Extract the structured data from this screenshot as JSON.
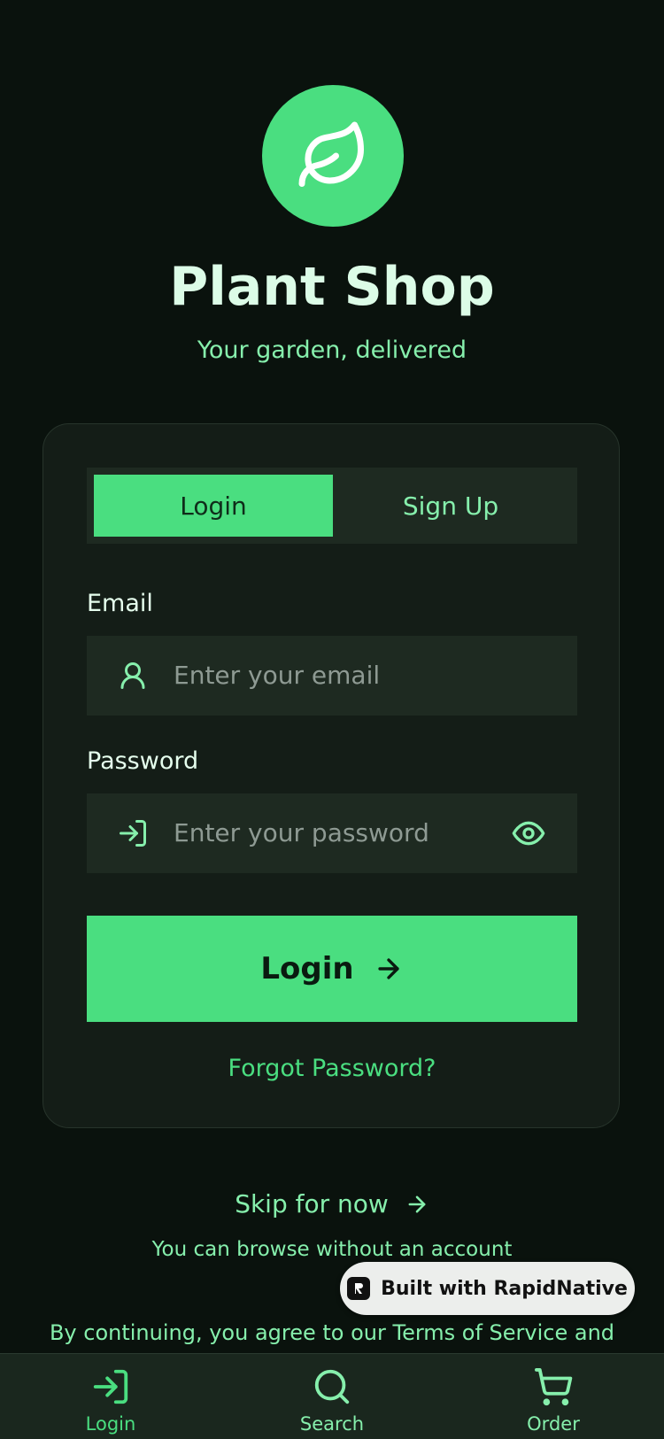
{
  "app": {
    "title": "Plant Shop",
    "subtitle": "Your garden, delivered",
    "logo_icon": "leaf-icon",
    "accent_color": "#4ade80"
  },
  "auth_tabs": [
    {
      "label": "Login",
      "selected": true
    },
    {
      "label": "Sign Up",
      "selected": false
    }
  ],
  "form": {
    "email_label": "Email",
    "email_placeholder": "Enter your email",
    "email_icon": "user-icon",
    "password_label": "Password",
    "password_placeholder": "Enter your password",
    "password_icon": "login-icon",
    "password_toggle_icon": "eye-icon",
    "submit_label": "Login",
    "submit_icon": "arrow-right-icon",
    "forgot_label": "Forgot Password?"
  },
  "skip": {
    "label": "Skip for now",
    "caption": "You can browse without an account"
  },
  "badge": {
    "label": "Built with RapidNative"
  },
  "terms_text": "By continuing, you agree to our Terms of Service and",
  "bottom_nav": [
    {
      "label": "Login",
      "icon": "login-icon",
      "active": true
    },
    {
      "label": "Search",
      "icon": "search-icon",
      "active": false
    },
    {
      "label": "Order",
      "icon": "cart-icon",
      "active": false
    }
  ]
}
